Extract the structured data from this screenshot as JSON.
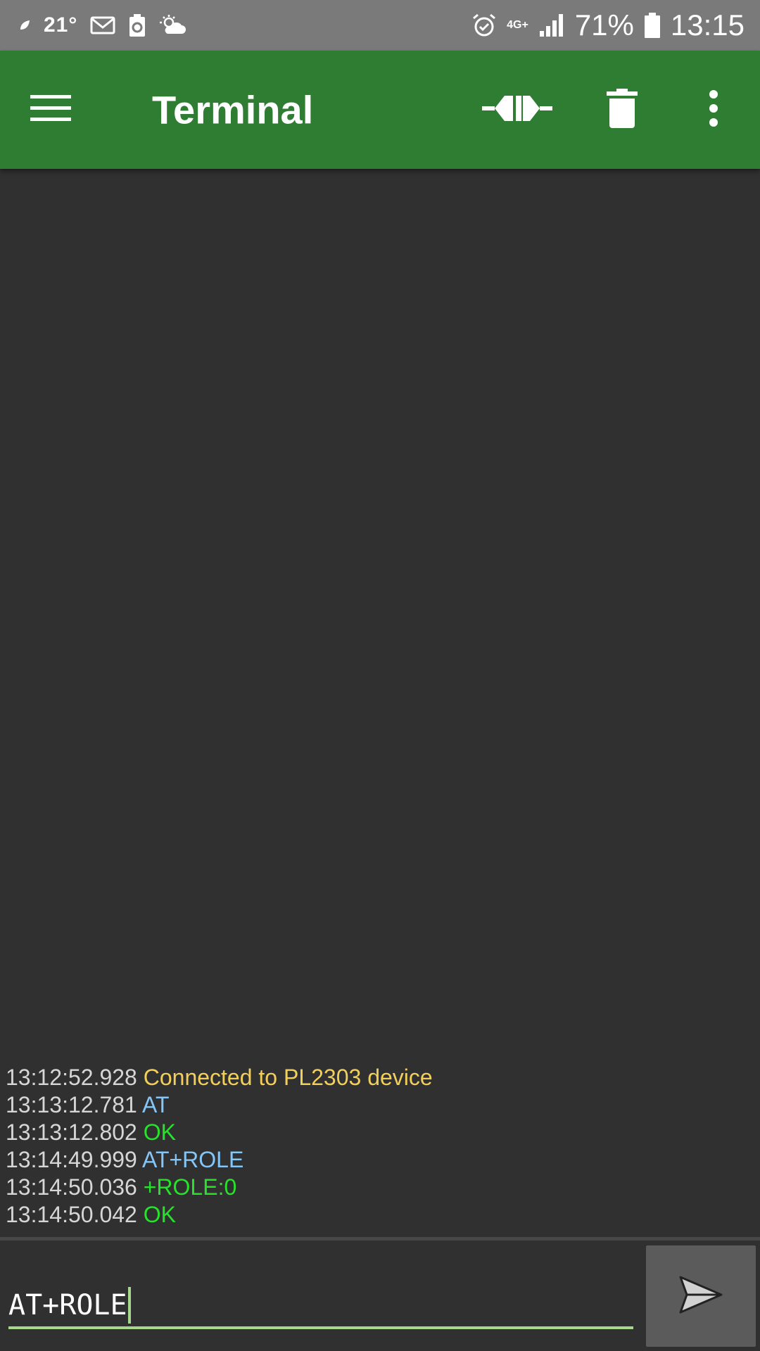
{
  "status_bar": {
    "temperature": "21°",
    "network_label": "4G+",
    "battery_percent": "71%",
    "time": "13:15",
    "icons_left": [
      "leaf-icon",
      "mail-icon",
      "battery-saver-icon",
      "weather-cloudy-icon"
    ],
    "icons_right": [
      "alarm-icon",
      "network-4g-icon",
      "signal-icon",
      "battery-icon"
    ]
  },
  "app_bar": {
    "title": "Terminal",
    "background": "#2f7d32",
    "actions": [
      "menu-icon",
      "connect-icon",
      "trash-icon",
      "more-vert-icon"
    ]
  },
  "terminal": {
    "lines": [
      {
        "timestamp": "13:12:52.928",
        "text": "Connected to PL2303 device",
        "kind": "status"
      },
      {
        "timestamp": "13:13:12.781",
        "text": "AT",
        "kind": "send"
      },
      {
        "timestamp": "13:13:12.802",
        "text": "OK",
        "kind": "receive"
      },
      {
        "timestamp": "13:14:49.999",
        "text": "AT+ROLE",
        "kind": "send"
      },
      {
        "timestamp": "13:14:50.036",
        "text": "+ROLE:0",
        "kind": "receive"
      },
      {
        "timestamp": "13:14:50.042",
        "text": "OK",
        "kind": "receive"
      }
    ],
    "colors": {
      "timestamp": "#d6d6d6",
      "status": "#f2cf5b",
      "send": "#85c6f7",
      "receive": "#26e22a"
    }
  },
  "input": {
    "value": "AT+ROLE",
    "accent": "#a5d88a"
  },
  "send_button": {
    "icon": "send-icon"
  }
}
